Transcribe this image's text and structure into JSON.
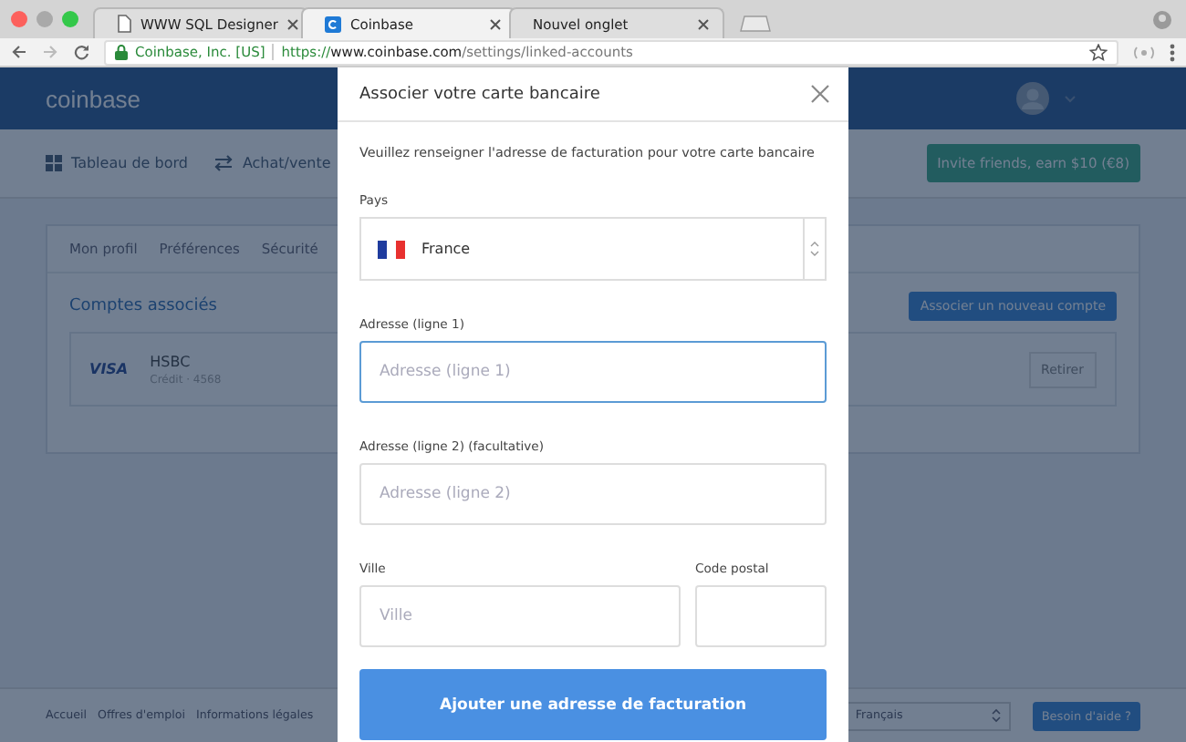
{
  "browser": {
    "tabs": [
      {
        "title": "WWW SQL Designer",
        "selected": false
      },
      {
        "title": "Coinbase",
        "selected": true
      },
      {
        "title": "Nouvel onglet",
        "selected": false
      }
    ],
    "site_identity": "Coinbase, Inc. [US]",
    "url_scheme": "https://",
    "url_host": "www.coinbase.com",
    "url_path": "/settings/linked-accounts"
  },
  "header": {
    "logo": "coinbase"
  },
  "nav": {
    "items": [
      {
        "label": "Tableau de bord"
      },
      {
        "label": "Achat/vente"
      }
    ],
    "invite_button": "Invite friends, earn $10 (€8)"
  },
  "settings": {
    "tabs": [
      {
        "label": "Mon profil"
      },
      {
        "label": "Préférences"
      },
      {
        "label": "Sécurité"
      }
    ],
    "section_title": "Comptes associés",
    "add_button": "Associer un nouveau compte",
    "accounts": [
      {
        "brand": "VISA",
        "bank": "HSBC",
        "detail": "Crédit · 4568",
        "remove_button": "Retirer"
      }
    ]
  },
  "footer": {
    "links": [
      "Accueil",
      "Offres d'emploi",
      "Informations légales"
    ],
    "language": "Français",
    "help_button": "Besoin d'aide ?"
  },
  "modal": {
    "title": "Associer votre carte bancaire",
    "description": "Veuillez renseigner l'adresse de facturation pour votre carte bancaire",
    "fields": [
      {
        "kind": "country",
        "label": "Pays",
        "value": "France"
      },
      {
        "kind": "text",
        "label": "Adresse (ligne 1)",
        "placeholder": "Adresse (ligne 1)",
        "focused": true
      },
      {
        "kind": "text",
        "label": "Adresse (ligne 2) (facultative)",
        "placeholder": "Adresse (ligne 2)",
        "focused": false
      },
      {
        "kind": "pair",
        "items": [
          {
            "label": "Ville",
            "placeholder": "Ville",
            "focused": false
          },
          {
            "label": "Code postal",
            "focused": false
          }
        ]
      }
    ],
    "submit_button": "Ajouter une adresse de facturation"
  }
}
